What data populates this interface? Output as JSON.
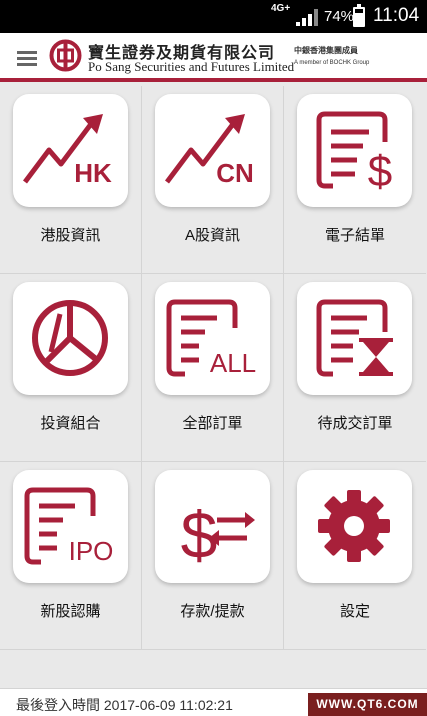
{
  "status_bar": {
    "network": "4G+",
    "battery_percent": "74%",
    "time": "11:04"
  },
  "header": {
    "company_name_cn": "寶生證券及期貨有限公司",
    "company_name_en": "Po Sang Securities and Futures Limited",
    "member_cn": "中銀香港集團成員",
    "member_en": "A member of BOCHK Group"
  },
  "tiles": [
    {
      "label": "港股資訊",
      "icon": "hk-stock-chart-icon",
      "icon_text": "HK"
    },
    {
      "label": "A股資訊",
      "icon": "cn-stock-chart-icon",
      "icon_text": "CN"
    },
    {
      "label": "電子結單",
      "icon": "e-statement-icon"
    },
    {
      "label": "投資組合",
      "icon": "portfolio-pie-icon"
    },
    {
      "label": "全部訂單",
      "icon": "all-orders-icon",
      "icon_text": "ALL"
    },
    {
      "label": "待成交訂單",
      "icon": "pending-orders-icon"
    },
    {
      "label": "新股認購",
      "icon": "ipo-subscription-icon",
      "icon_text": "IPO"
    },
    {
      "label": "存款/提款",
      "icon": "deposit-withdraw-icon"
    },
    {
      "label": "設定",
      "icon": "gear-icon"
    }
  ],
  "footer": {
    "last_login": "最後登入時間 2017-06-09 11:02:21"
  },
  "watermark": "WWW.QT6.COM",
  "colors": {
    "brand": "#a8203a",
    "background": "#e9e9e9",
    "status_bar": "#000000"
  }
}
